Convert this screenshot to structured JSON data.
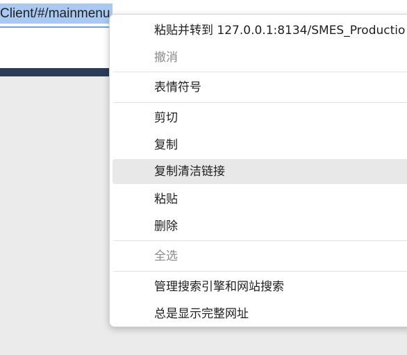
{
  "address_bar": {
    "url_fragment": "Client/#/mainmenu"
  },
  "context_menu": {
    "items": [
      {
        "label": "粘贴并转到 127.0.0.1:8134/SMES_Productio",
        "state": "enabled"
      },
      {
        "label": "撤消",
        "state": "disabled"
      },
      {
        "label": "表情符号",
        "state": "enabled"
      },
      {
        "label": "剪切",
        "state": "enabled"
      },
      {
        "label": "复制",
        "state": "enabled"
      },
      {
        "label": "复制清洁链接",
        "state": "hovered"
      },
      {
        "label": "粘贴",
        "state": "enabled"
      },
      {
        "label": "删除",
        "state": "enabled"
      },
      {
        "label": "全选",
        "state": "disabled"
      },
      {
        "label": "管理搜索引擎和网站搜索",
        "state": "enabled"
      },
      {
        "label": "总是显示完整网址",
        "state": "enabled"
      }
    ]
  },
  "colors": {
    "selection_highlight": "#a9c9f1",
    "page_header_bar": "#2b3c56",
    "page_background": "#ebebeb",
    "menu_hover": "#e8e8e8",
    "disabled_text": "#8a8a8a"
  }
}
